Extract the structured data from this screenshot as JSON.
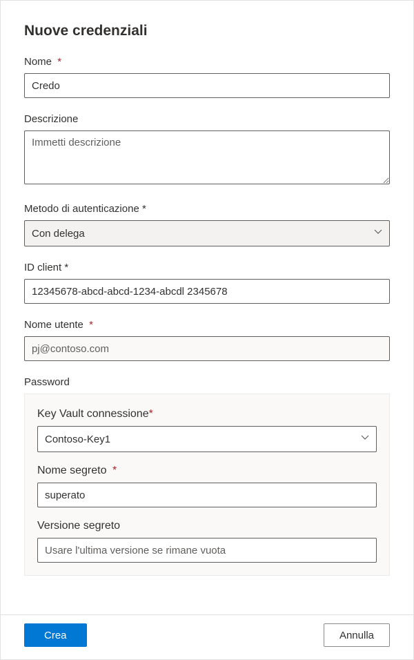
{
  "title": "Nuove credenziali",
  "fields": {
    "name": {
      "label": "Nome",
      "value": "Credo",
      "required": true
    },
    "description": {
      "label": "Descrizione",
      "placeholder": "Immetti descrizione",
      "required": false
    },
    "authMethod": {
      "label": "Metodo di autenticazione *",
      "value": "Con delega"
    },
    "clientId": {
      "label": "ID client *",
      "value": "12345678-abcd-abcd-1234-abcdl 2345678"
    },
    "username": {
      "label": "Nome utente",
      "value": "pj@contoso.com",
      "required": true
    },
    "password": {
      "label": "Password",
      "keyVault": {
        "label": "Key Vault connessione",
        "value": "Contoso-Key1",
        "required": true
      },
      "secretName": {
        "label": "Nome segreto",
        "value": "superato",
        "required": true
      },
      "secretVersion": {
        "label": "Versione segreto",
        "placeholder": "Usare l'ultima versione se rimane vuota"
      }
    }
  },
  "buttons": {
    "create": "Crea",
    "cancel": "Annulla"
  }
}
